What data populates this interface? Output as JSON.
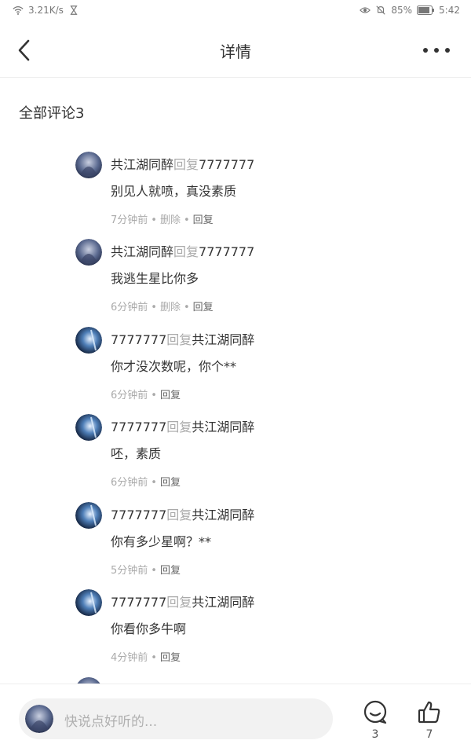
{
  "status_bar": {
    "net_speed": "3.21K/s",
    "battery": "85%",
    "time": "5:42"
  },
  "header": {
    "title": "详情"
  },
  "section_title": "全部评论3",
  "comments": [
    {
      "author": "共江湖同醉",
      "reply_word": "回复",
      "target": "7777777",
      "text": "别见人就喷，真没素质",
      "time": "7分钟前",
      "delete": "删除",
      "reply": "回复"
    },
    {
      "author": "共江湖同醉",
      "reply_word": "回复",
      "target": "7777777",
      "text": "我逃生星比你多",
      "time": "6分钟前",
      "delete": "删除",
      "reply": "回复"
    },
    {
      "author": "7777777",
      "reply_word": "回复",
      "target": "共江湖同醉",
      "text": "你才没次数呢，你个**",
      "time": "6分钟前",
      "reply": "回复"
    },
    {
      "author": "7777777",
      "reply_word": "回复",
      "target": "共江湖同醉",
      "text": "呸，素质",
      "time": "6分钟前",
      "reply": "回复"
    },
    {
      "author": "7777777",
      "reply_word": "回复",
      "target": "共江湖同醉",
      "text": "你有多少星啊？**",
      "time": "5分钟前",
      "reply": "回复"
    },
    {
      "author": "7777777",
      "reply_word": "回复",
      "target": "共江湖同醉",
      "text": "你看你多牛啊",
      "time": "4分钟前",
      "reply": "回复"
    }
  ],
  "bottom_bar": {
    "input_placeholder": "快说点好听的...",
    "comment_count": "3",
    "like_count": "7"
  },
  "colors": {
    "text": "#333333",
    "muted": "#aaaaaa",
    "input_bg": "#f2f2f2"
  }
}
